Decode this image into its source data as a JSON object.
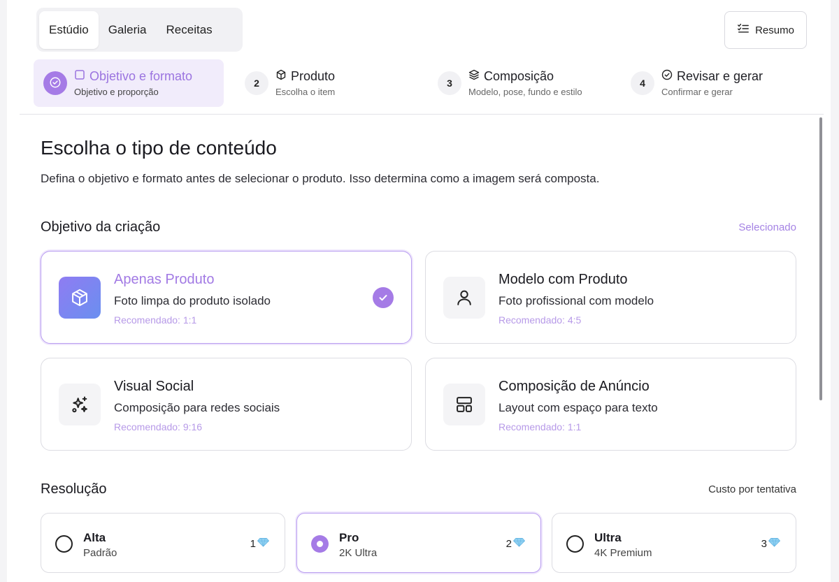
{
  "tabs": [
    {
      "label": "Estúdio",
      "active": true
    },
    {
      "label": "Galeria",
      "active": false
    },
    {
      "label": "Receitas",
      "active": false
    }
  ],
  "summary_button": {
    "label": "Resumo",
    "icon": "checklist-icon"
  },
  "stepper": [
    {
      "number": "",
      "title": "Objetivo e formato",
      "subtitle": "Objetivo e proporção",
      "icon": "square-icon",
      "state": "current"
    },
    {
      "number": "2",
      "title": "Produto",
      "subtitle": "Escolha o item",
      "icon": "box-icon",
      "state": "pending"
    },
    {
      "number": "3",
      "title": "Composição",
      "subtitle": "Modelo, pose, fundo e estilo",
      "icon": "layers-icon",
      "state": "pending"
    },
    {
      "number": "4",
      "title": "Revisar e gerar",
      "subtitle": "Confirmar e gerar",
      "icon": "check-circle-icon",
      "state": "pending"
    }
  ],
  "main": {
    "title": "Escolha o tipo de conteúdo",
    "description": "Defina o objetivo e formato antes de selecionar o produto. Isso determina como a imagem será composta."
  },
  "objective": {
    "section_title": "Objetivo da criação",
    "status": "Selecionado",
    "cards": [
      {
        "title": "Apenas Produto",
        "description": "Foto limpa do produto isolado",
        "recommendation": "Recomendado: 1:1",
        "icon": "box-icon",
        "selected": true
      },
      {
        "title": "Modelo com Produto",
        "description": "Foto profissional com modelo",
        "recommendation": "Recomendado: 4:5",
        "icon": "person-icon",
        "selected": false
      },
      {
        "title": "Visual Social",
        "description": "Composição para redes sociais",
        "recommendation": "Recomendado: 9:16",
        "icon": "sparkles-icon",
        "selected": false
      },
      {
        "title": "Composição de Anúncio",
        "description": "Layout com espaço para texto",
        "recommendation": "Recomendado: 1:1",
        "icon": "layout-icon",
        "selected": false
      }
    ]
  },
  "resolution": {
    "section_title": "Resolução",
    "note": "Custo por tentativa",
    "options": [
      {
        "name": "Alta",
        "subtitle": "Padrão",
        "cost": "1",
        "selected": false
      },
      {
        "name": "Pro",
        "subtitle": "2K Ultra",
        "cost": "2",
        "selected": true
      },
      {
        "name": "Ultra",
        "subtitle": "4K Premium",
        "cost": "3",
        "selected": false
      }
    ]
  },
  "colors": {
    "accent": "#a57be6",
    "accent_light": "#f1ecfb",
    "border": "#dcdce2"
  }
}
